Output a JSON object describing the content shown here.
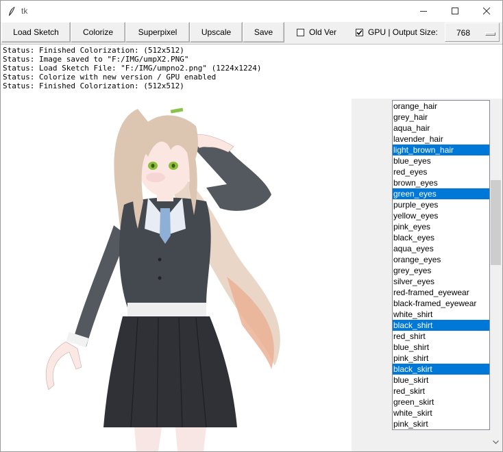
{
  "window": {
    "title": "tk"
  },
  "toolbar": {
    "load_sketch": "Load Sketch",
    "colorize": "Colorize",
    "superpixel": "Superpixel",
    "upscale": "Upscale",
    "save": "Save",
    "old_ver_label": "Old Ver",
    "old_ver_checked": false,
    "gpu_label": "GPU | Output Size:",
    "gpu_checked": true,
    "output_size": "768"
  },
  "status_lines": [
    "Status: Finished Colorization: (512x512)",
    "Status: Image saved to \"F:/IMG/umpX2.PNG\"",
    "Status: Load Sketch File: \"F:/IMG/umpno2.png\" (1224x1224)",
    "Status: Colorize with new version / GPU enabled",
    "Status: Finished Colorization: (512x512)"
  ],
  "tags": [
    {
      "label": "orange_hair",
      "selected": false
    },
    {
      "label": "grey_hair",
      "selected": false
    },
    {
      "label": "aqua_hair",
      "selected": false
    },
    {
      "label": "lavender_hair",
      "selected": false
    },
    {
      "label": "light_brown_hair",
      "selected": true
    },
    {
      "label": "blue_eyes",
      "selected": false
    },
    {
      "label": "red_eyes",
      "selected": false
    },
    {
      "label": "brown_eyes",
      "selected": false
    },
    {
      "label": "green_eyes",
      "selected": true
    },
    {
      "label": "purple_eyes",
      "selected": false
    },
    {
      "label": "yellow_eyes",
      "selected": false
    },
    {
      "label": "pink_eyes",
      "selected": false
    },
    {
      "label": "black_eyes",
      "selected": false
    },
    {
      "label": "aqua_eyes",
      "selected": false
    },
    {
      "label": "orange_eyes",
      "selected": false
    },
    {
      "label": "grey_eyes",
      "selected": false
    },
    {
      "label": "silver_eyes",
      "selected": false
    },
    {
      "label": "red-framed_eyewear",
      "selected": false
    },
    {
      "label": "black-framed_eyewear",
      "selected": false
    },
    {
      "label": "white_shirt",
      "selected": false
    },
    {
      "label": "black_shirt",
      "selected": true
    },
    {
      "label": "red_shirt",
      "selected": false
    },
    {
      "label": "blue_shirt",
      "selected": false
    },
    {
      "label": "pink_shirt",
      "selected": false
    },
    {
      "label": "black_skirt",
      "selected": true
    },
    {
      "label": "blue_skirt",
      "selected": false
    },
    {
      "label": "red_skirt",
      "selected": false
    },
    {
      "label": "green_skirt",
      "selected": false
    },
    {
      "label": "white_skirt",
      "selected": false
    },
    {
      "label": "pink_skirt",
      "selected": false
    }
  ],
  "colors": {
    "selection": "#0078d7",
    "hair": "#d8c3b0",
    "hair_tips": "#e9a98a",
    "jacket": "#44484f",
    "skirt": "#2f3137",
    "skin": "#fbe6e2",
    "collar": "#e8ecf5",
    "tie": "#8fb0d6",
    "eyes": "#8cbf3a"
  }
}
